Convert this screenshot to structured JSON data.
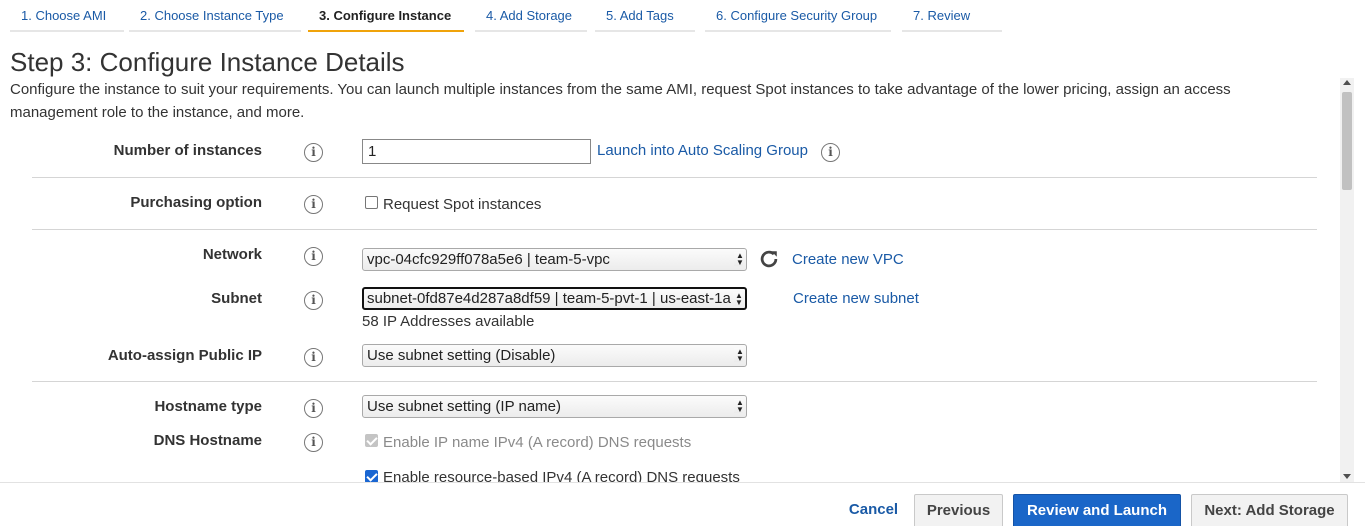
{
  "wizard_steps": [
    {
      "label": "1. Choose AMI",
      "active": false
    },
    {
      "label": "2. Choose Instance Type",
      "active": false
    },
    {
      "label": "3. Configure Instance",
      "active": true
    },
    {
      "label": "4. Add Storage",
      "active": false
    },
    {
      "label": "5. Add Tags",
      "active": false
    },
    {
      "label": "6. Configure Security Group",
      "active": false
    },
    {
      "label": "7. Review",
      "active": false
    }
  ],
  "page": {
    "title": "Step 3: Configure Instance Details",
    "description": "Configure the instance to suit your requirements. You can launch multiple instances from the same AMI, request Spot instances to take advantage of the lower pricing, assign an access management role to the instance, and more."
  },
  "form": {
    "instances": {
      "label": "Number of instances",
      "value": "1",
      "asg_link": "Launch into Auto Scaling Group"
    },
    "purchasing": {
      "label": "Purchasing option",
      "spot_label": "Request Spot instances",
      "spot_checked": false
    },
    "network": {
      "label": "Network",
      "value": "vpc-04cfc929ff078a5e6 | team-5-vpc",
      "create_link": "Create new VPC"
    },
    "subnet": {
      "label": "Subnet",
      "value": "subnet-0fd87e4d287a8df59 | team-5-pvt-1 | us-east-1a",
      "available": "58 IP Addresses available",
      "create_link": "Create new subnet"
    },
    "public_ip": {
      "label": "Auto-assign Public IP",
      "value": "Use subnet setting (Disable)"
    },
    "hostname_type": {
      "label": "Hostname type",
      "value": "Use subnet setting (IP name)"
    },
    "dns_hostname": {
      "label": "DNS Hostname",
      "ipv4_label": "Enable IP name IPv4 (A record) DNS requests",
      "ipv4_checked": true,
      "ipv4_disabled": true,
      "resource_label": "Enable resource-based IPv4 (A record) DNS requests",
      "resource_checked": true
    }
  },
  "footer": {
    "cancel": "Cancel",
    "previous": "Previous",
    "review": "Review and Launch",
    "next": "Next: Add Storage"
  },
  "colors": {
    "link": "#1a5aa6",
    "active_tab_underline": "#f0a30a",
    "primary_button": "#1a66c8"
  }
}
